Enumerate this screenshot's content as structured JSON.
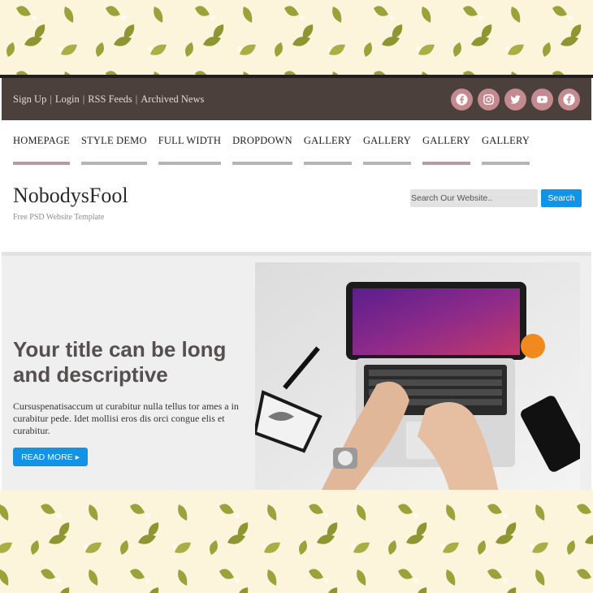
{
  "topbar": {
    "links": [
      "Sign Up",
      "Login",
      "RSS Feeds",
      "Archived News"
    ],
    "social_icons": [
      "facebook-icon",
      "instagram-icon",
      "twitter-icon",
      "youtube-icon",
      "facebook-icon"
    ]
  },
  "nav": {
    "items": [
      "HOMEPAGE",
      "STYLE DEMO",
      "FULL WIDTH",
      "DROPDOWN",
      "GALLERY",
      "GALLERY",
      "GALLERY",
      "GALLERY"
    ]
  },
  "brand": {
    "name": "NobodysFool",
    "tagline": "Free PSD Website Template"
  },
  "search": {
    "placeholder": "Search Our Website..",
    "button_label": "Search"
  },
  "hero": {
    "title": "Your title can be long and descriptive",
    "body": "Cursuspenatisaccum ut curabitur nulla tellus tor ames a in curabitur pede. Idet mollisi eros dis orci congue elis et curabitur.",
    "button_label": "READ MORE",
    "button_arrow": "▸"
  },
  "colors": {
    "page_bg": "#fdf4dc",
    "leaf": "#9aa23a",
    "topbar": "#4b403c",
    "social_circle": "#c48a8f",
    "accent_blue": "#1393e6"
  }
}
